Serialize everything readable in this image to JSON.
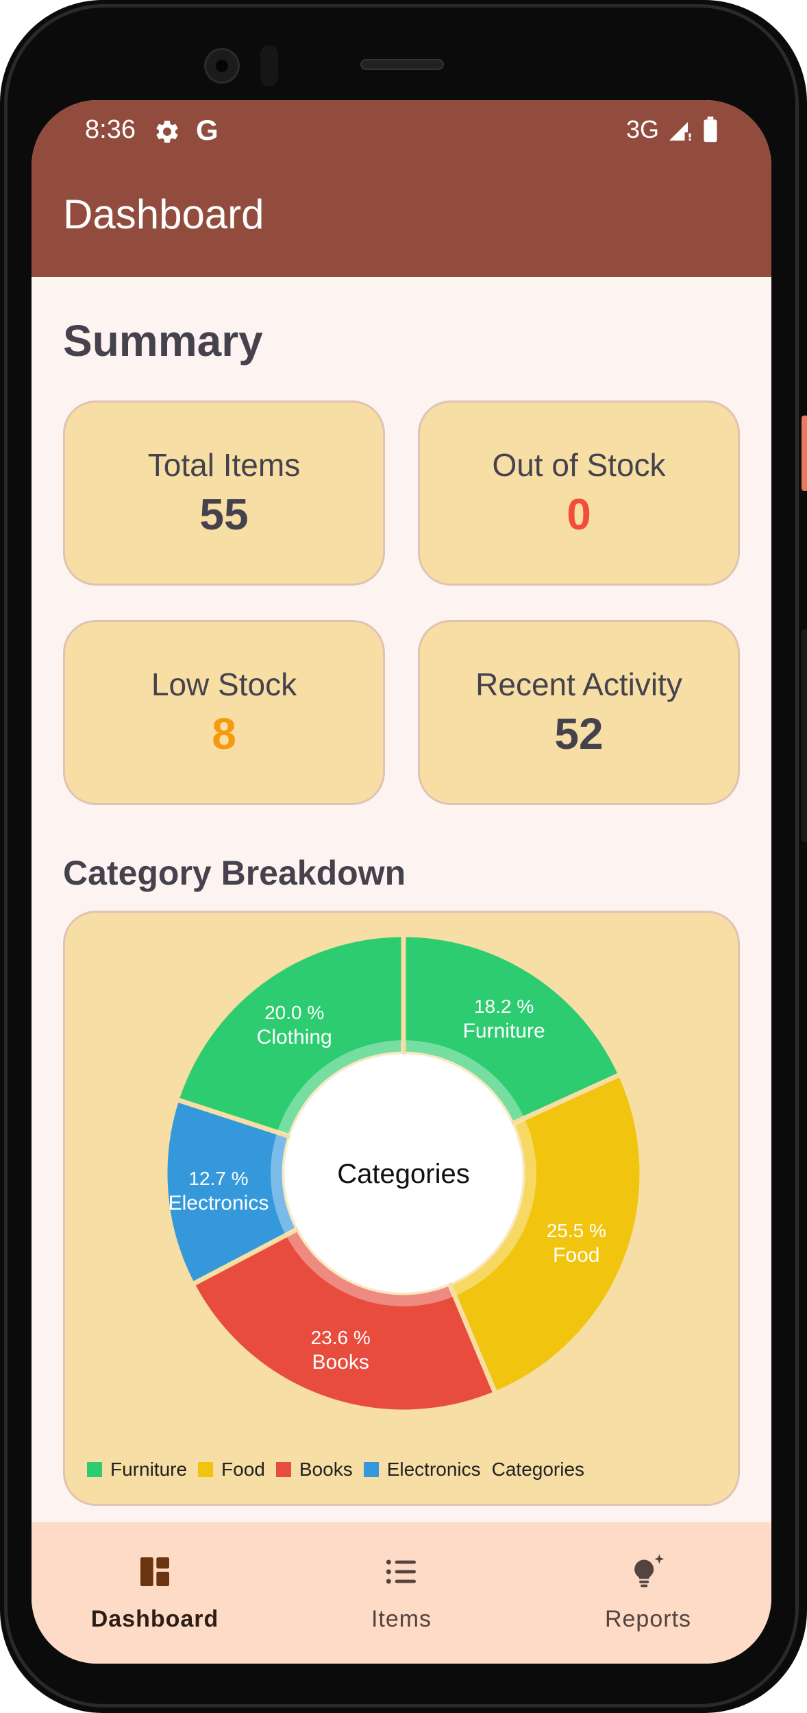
{
  "status_bar": {
    "time": "8:36",
    "google_letter": "G",
    "network": "3G",
    "icons": [
      "gear-icon",
      "signal-icon",
      "battery-icon"
    ]
  },
  "app_bar": {
    "title": "Dashboard"
  },
  "summary": {
    "title": "Summary",
    "cards": [
      {
        "label": "Total Items",
        "value": "55",
        "color": "#45424d"
      },
      {
        "label": "Out of Stock",
        "value": "0",
        "color": "#f44b3a"
      },
      {
        "label": "Low Stock",
        "value": "8",
        "color": "#f59a0c"
      },
      {
        "label": "Recent Activity",
        "value": "52",
        "color": "#45424d"
      }
    ]
  },
  "category_breakdown": {
    "title": "Category Breakdown"
  },
  "chart_data": {
    "type": "pie",
    "center_label": "Categories",
    "slices": [
      {
        "label": "Furniture",
        "percent": 18.2,
        "percent_text": "18.2 %",
        "color": "#2ecc71"
      },
      {
        "label": "Food",
        "percent": 25.5,
        "percent_text": "25.5 %",
        "color": "#f1c40f"
      },
      {
        "label": "Books",
        "percent": 23.6,
        "percent_text": "23.6 %",
        "color": "#e74c3c"
      },
      {
        "label": "Electronics",
        "percent": 12.7,
        "percent_text": "12.7 %",
        "color": "#3498db"
      },
      {
        "label": "Clothing",
        "percent": 20.0,
        "percent_text": "20.0 %",
        "color": "#2ecc71"
      }
    ],
    "legend": [
      {
        "label": "Furniture",
        "color": "#2ecc71"
      },
      {
        "label": "Food",
        "color": "#f1c40f"
      },
      {
        "label": "Books",
        "color": "#e74c3c"
      },
      {
        "label": "Electronics",
        "color": "#3498db"
      },
      {
        "label": "Categories",
        "color": ""
      }
    ],
    "legend_position": "bottom"
  },
  "bottom_nav": {
    "items": [
      {
        "label": "Dashboard",
        "icon": "dashboard-icon",
        "active": true
      },
      {
        "label": "Items",
        "icon": "list-icon",
        "active": false
      },
      {
        "label": "Reports",
        "icon": "lightbulb-icon",
        "active": false
      }
    ]
  },
  "colors": {
    "primary": "#914c3e",
    "background": "#fdf4f2",
    "card": "#f6dea4",
    "nav_bar": "#fddbc6"
  }
}
